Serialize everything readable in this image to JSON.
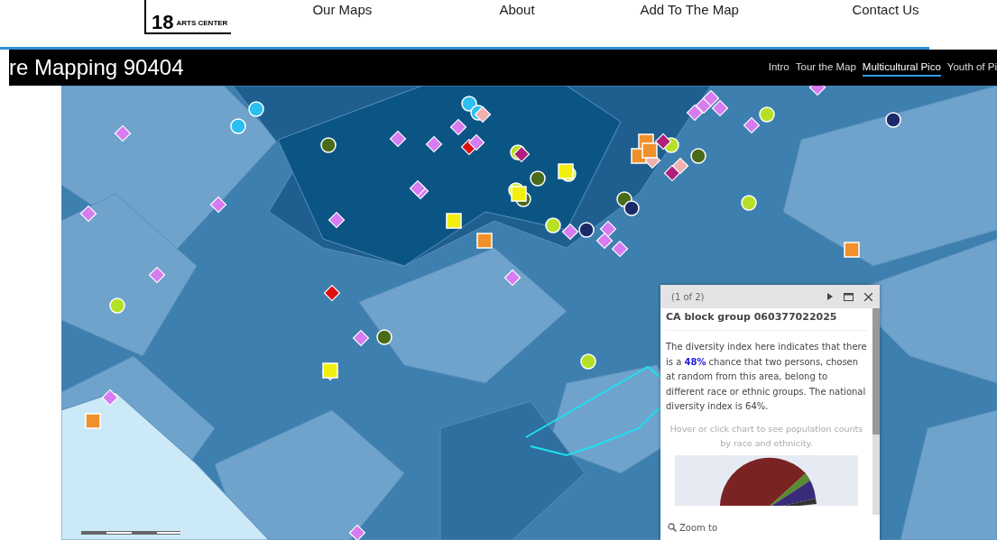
{
  "header": {
    "logo": {
      "number": "18",
      "text": "ARTS CENTER"
    },
    "nav": [
      "Our Maps",
      "About",
      "Add To The Map",
      "Contact Us"
    ]
  },
  "app_bar": {
    "title": "re Mapping 90404",
    "tabs": [
      {
        "label": "Intro",
        "selected": false
      },
      {
        "label": "Tour the Map",
        "selected": false
      },
      {
        "label": "Multicultural Pico",
        "selected": true
      },
      {
        "label": "Youth of Pi",
        "selected": false
      }
    ]
  },
  "popup": {
    "counter": "(1 of 2)",
    "title": "CA block group 060377022025",
    "body": "The diversity index here indicates that there is a **48%** chance that two persons, chosen at random from this area, belong to different race or ethnic groups. The national diversity index is 64%.",
    "hint": "Hover or click chart to see population counts by race and ethnicity.",
    "zoom_link": "Zoom to"
  }
}
